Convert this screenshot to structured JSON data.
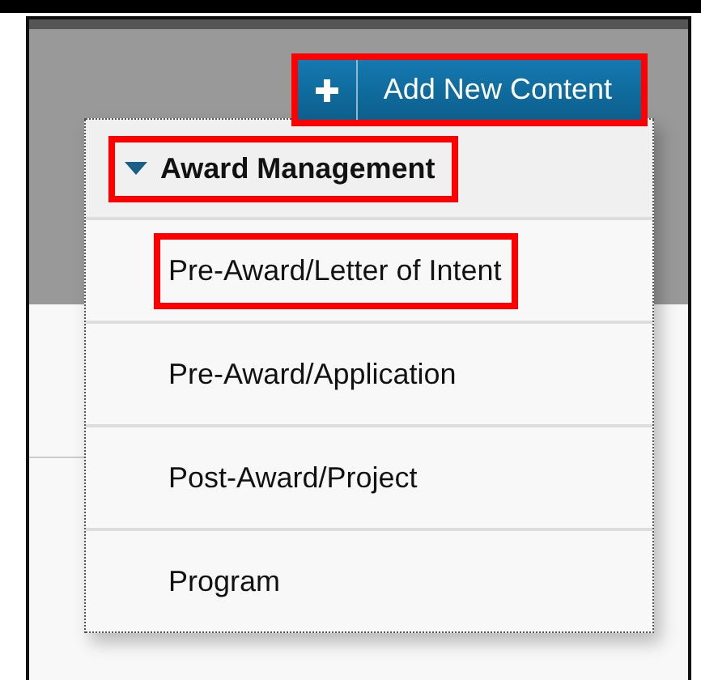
{
  "add_button": {
    "label": "Add New Content",
    "highlighted": true
  },
  "menu": {
    "section": {
      "label": "Award Management",
      "expanded": true,
      "highlighted": true
    },
    "items": [
      {
        "label": "Pre-Award/Letter of Intent",
        "highlighted": true
      },
      {
        "label": "Pre-Award/Application",
        "highlighted": false
      },
      {
        "label": "Post-Award/Project",
        "highlighted": false
      },
      {
        "label": "Program",
        "highlighted": false
      }
    ]
  }
}
